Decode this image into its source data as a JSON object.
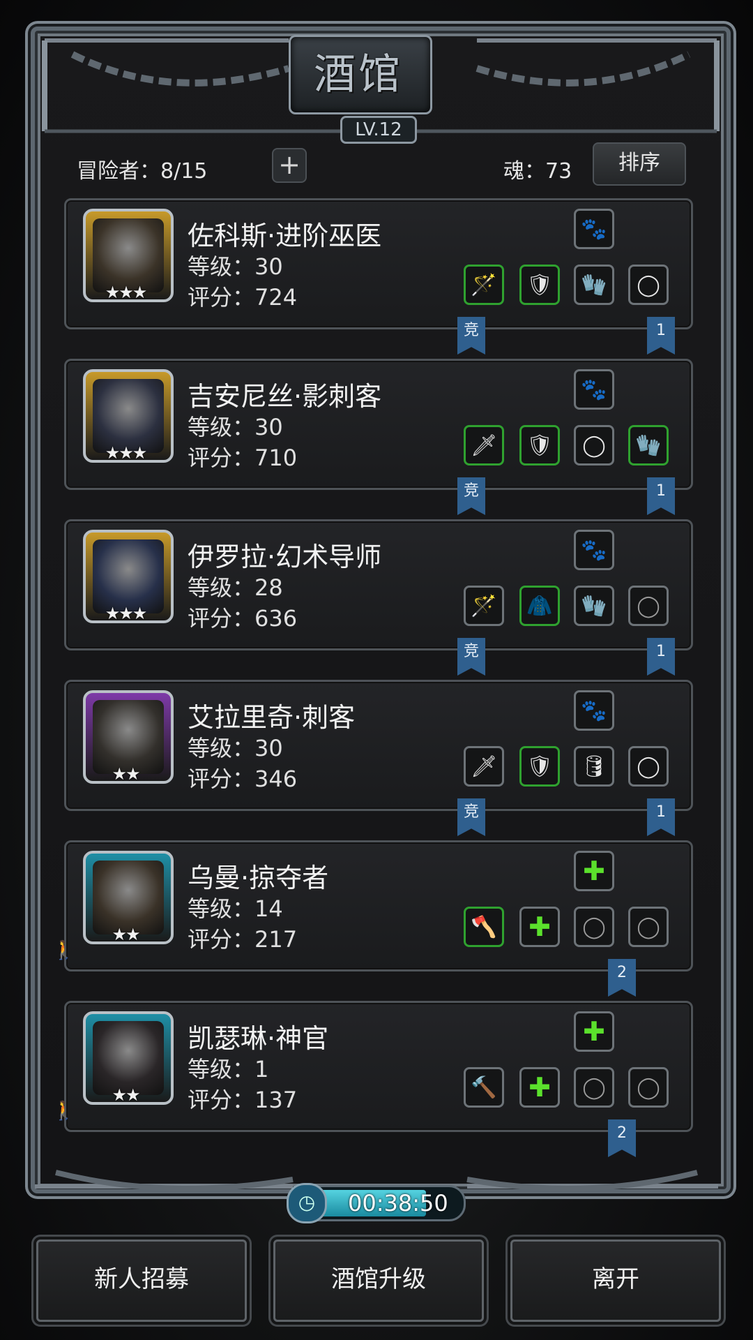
{
  "header": {
    "title": "酒馆",
    "level": "LV.12"
  },
  "topbar": {
    "adventurers": "冒险者：8/15",
    "plus": "+",
    "soul": "魂：73",
    "sort": "排序"
  },
  "heroes": [
    {
      "name": "佐科斯·进阶巫医",
      "level": "等级：30",
      "score": "评分：724",
      "stars": "★★★",
      "frame": "#c79a2a",
      "bg": "#3b3328",
      "ribbon_left": "竞",
      "ribbon_right": "1"
    },
    {
      "name": "吉安尼丝·影刺客",
      "level": "等级：30",
      "score": "评分：710",
      "stars": "★★★",
      "frame": "#c79a2a",
      "bg": "#2c3040",
      "ribbon_left": "竞",
      "ribbon_right": "1"
    },
    {
      "name": "伊罗拉·幻术导师",
      "level": "等级：28",
      "score": "评分：636",
      "stars": "★★★",
      "frame": "#c79a2a",
      "bg": "#27304a",
      "ribbon_left": "竞",
      "ribbon_right": "1"
    },
    {
      "name": "艾拉里奇·刺客",
      "level": "等级：30",
      "score": "评分：346",
      "stars": "★★",
      "frame": "#7e3aa8",
      "bg": "#33302c",
      "ribbon_left": "竞",
      "ribbon_right": "1"
    },
    {
      "name": "乌曼·掠夺者",
      "level": "等级：14",
      "score": "评分：217",
      "stars": "★★",
      "frame": "#1f8fa6",
      "bg": "#3a3228",
      "ribbon_right": "2"
    },
    {
      "name": "凯瑟琳·神官",
      "level": "等级：1",
      "score": "评分：137",
      "stars": "★★",
      "frame": "#1f8fa6",
      "bg": "#2a2628",
      "ribbon_right": "2"
    }
  ],
  "timer": "00:38:50",
  "buttons": {
    "recruit": "新人招募",
    "upgrade": "酒馆升级",
    "leave": "离开"
  }
}
